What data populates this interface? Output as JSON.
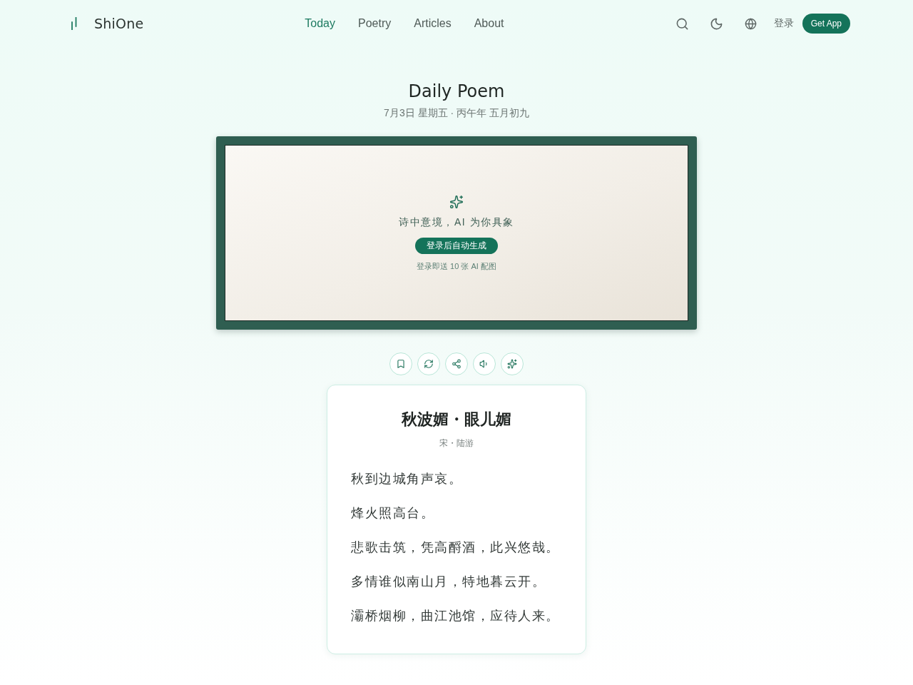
{
  "header": {
    "logo": "ShiOne",
    "nav": [
      {
        "label": "Today",
        "selected": true
      },
      {
        "label": "Poetry",
        "selected": false
      },
      {
        "label": "Articles",
        "selected": false
      },
      {
        "label": "About",
        "selected": false
      }
    ],
    "login": "登录",
    "get_app": "Get App"
  },
  "page": {
    "title": "Daily Poem",
    "date": "7月3日 星期五 · 丙午年 五月初九"
  },
  "illustration": {
    "caption": "诗中意境，AI 为你具象",
    "button": "登录后自动生成",
    "note": "登录即送 10 张 AI 配图"
  },
  "actions": [
    {
      "kind": "bookmark"
    },
    {
      "kind": "refresh"
    },
    {
      "kind": "share"
    },
    {
      "kind": "audio"
    },
    {
      "kind": "sparkle"
    }
  ],
  "poem": {
    "title": "秋波媚・眼儿媚",
    "author": "宋・陆游",
    "lines": [
      "秋到边城角声哀。",
      "烽火照高台。",
      "悲歌击筑，凭高酹酒，此兴悠哉。",
      "多情谁似南山月，特地暮云开。",
      "灞桥烟柳，曲江池馆，应待人来。"
    ]
  }
}
